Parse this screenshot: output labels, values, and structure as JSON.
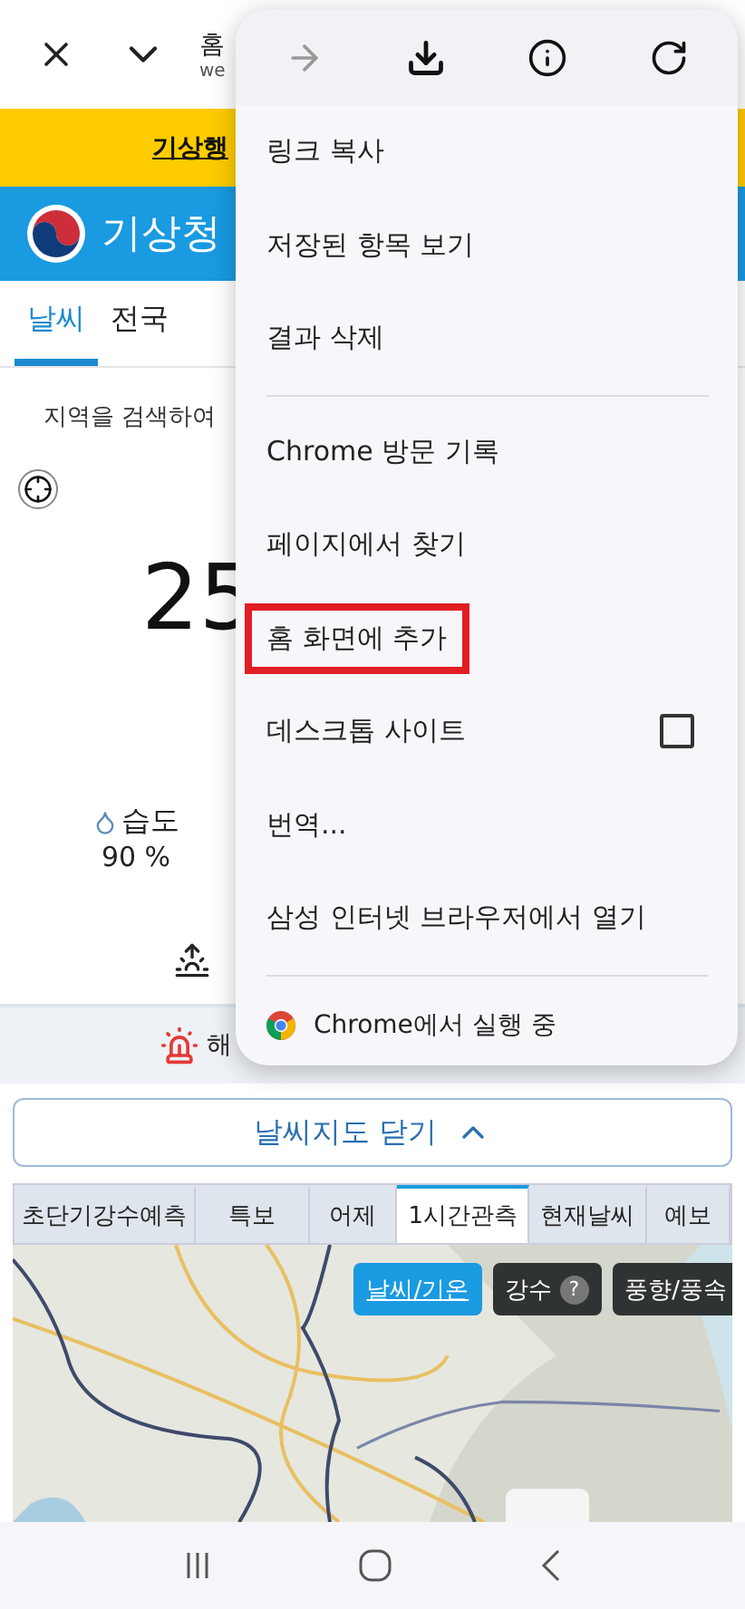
{
  "browser_bar": {
    "title": "홈",
    "url": "we"
  },
  "banner": {
    "text": "기상행"
  },
  "header": {
    "title": "기상청"
  },
  "nav_tabs": [
    {
      "label": "날씨",
      "selected": true
    },
    {
      "label": "전국",
      "selected": false
    }
  ],
  "search_hint": "지역을 검색하여",
  "current": {
    "temperature": "25",
    "humidity_label": "습도",
    "humidity_value": "90 %"
  },
  "alert": {
    "text": "해"
  },
  "map_toggle": {
    "label": "날씨지도 닫기",
    "expanded": true
  },
  "map_tabs": [
    {
      "label": "초단기강수예측",
      "selected": false
    },
    {
      "label": "특보",
      "selected": false
    },
    {
      "label": "어제",
      "selected": false
    },
    {
      "label": "1시간관측",
      "selected": true
    },
    {
      "label": "현재날씨",
      "selected": false
    },
    {
      "label": "예보",
      "selected": false
    }
  ],
  "map_layers": [
    {
      "label": "날씨/기온",
      "selected": true,
      "help": false
    },
    {
      "label": "강수",
      "selected": false,
      "help": true,
      "help_mark": "?"
    },
    {
      "label": "풍향/풍속",
      "selected": false,
      "help": false
    }
  ],
  "menu": {
    "toolbar": [
      {
        "kind": "forward",
        "disabled": true
      },
      {
        "kind": "download",
        "disabled": false
      },
      {
        "kind": "info",
        "disabled": false
      },
      {
        "kind": "reload",
        "disabled": false
      }
    ],
    "items": [
      {
        "kind": "item",
        "label": "링크 복사",
        "highlighted": false
      },
      {
        "kind": "item",
        "label": "저장된 항목 보기",
        "highlighted": false
      },
      {
        "kind": "item",
        "label": "결과 삭제",
        "highlighted": false
      },
      {
        "kind": "divider"
      },
      {
        "kind": "item",
        "label": "Chrome 방문 기록",
        "highlighted": false
      },
      {
        "kind": "item",
        "label": "페이지에서 찾기",
        "highlighted": false
      },
      {
        "kind": "item",
        "label": "홈 화면에 추가",
        "highlighted": true
      },
      {
        "kind": "checkbox",
        "label": "데스크톱 사이트",
        "checked": false,
        "highlighted": false
      },
      {
        "kind": "item",
        "label": "번역...",
        "highlighted": false
      },
      {
        "kind": "item",
        "label": "삼성 인터넷 브라우저에서 열기",
        "highlighted": false
      },
      {
        "kind": "divider"
      }
    ],
    "footer": "Chrome에서 실행 중"
  }
}
